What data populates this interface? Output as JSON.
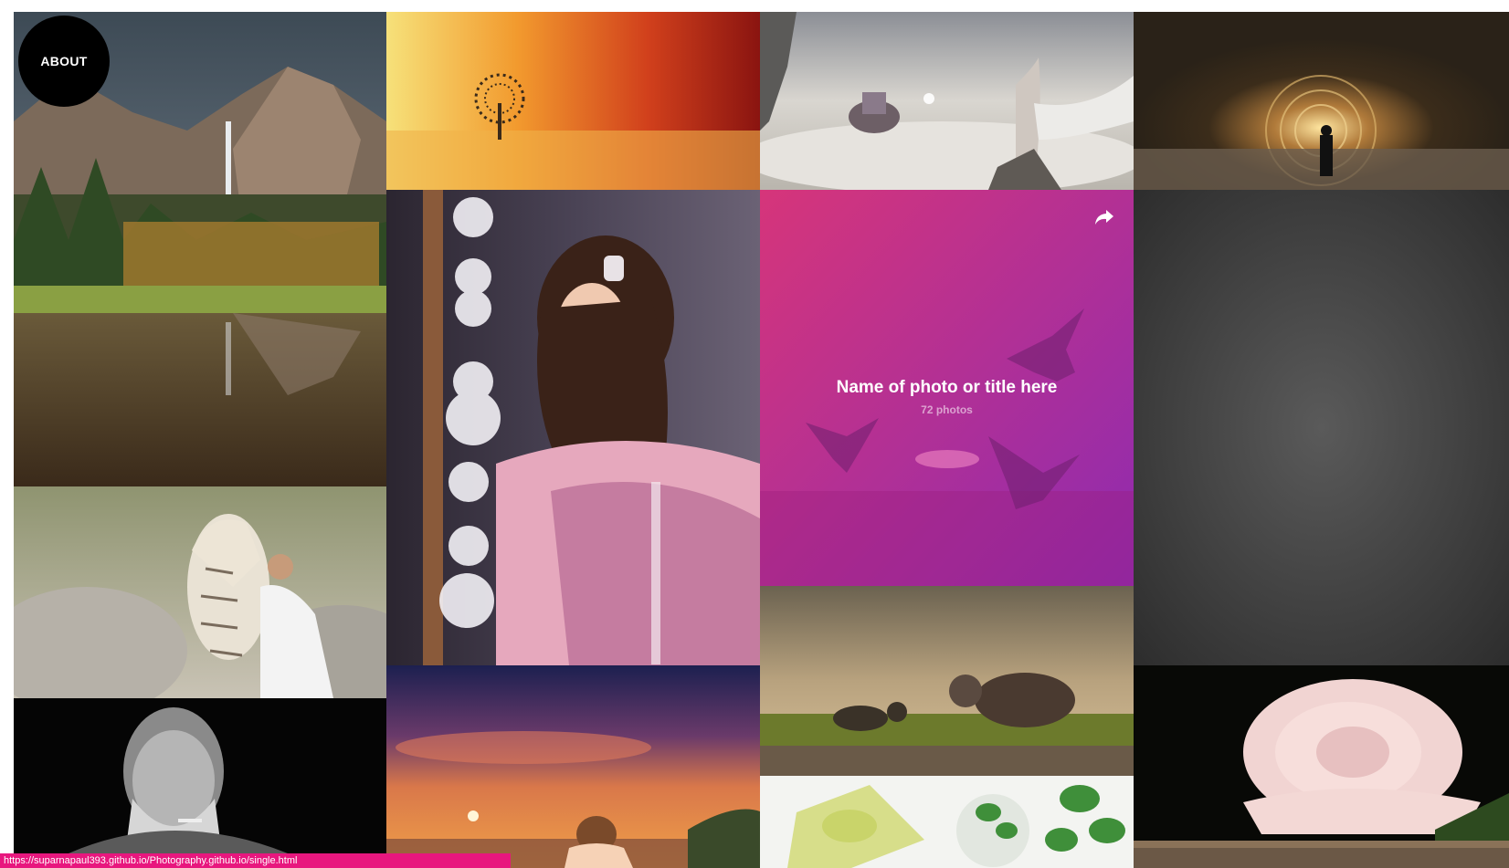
{
  "nav": {
    "about_label": "ABOUT"
  },
  "featured": {
    "title": "Name of photo or title here",
    "count": "72 photos",
    "share_icon": "share-arrow-icon",
    "gradient": [
      "#d6357a",
      "#8e2bb0"
    ]
  },
  "gallery": {
    "photos": [
      "yosemite-waterfall",
      "tree-in-sunset-water",
      "floating-castle-woman",
      "glowing-portal-man",
      "girl-at-mirror",
      "tiger-and-woman",
      "grey-cats-at-dusk",
      "old-man-portrait",
      "sunset-girl",
      "pink-rose",
      "mint-and-oil-bottle"
    ]
  },
  "status_bar": {
    "url": "https://suparnapaul393.github.io/Photography.github.io/single.html"
  },
  "colors": {
    "accent": "#e8177e",
    "about_bg": "#000000"
  }
}
